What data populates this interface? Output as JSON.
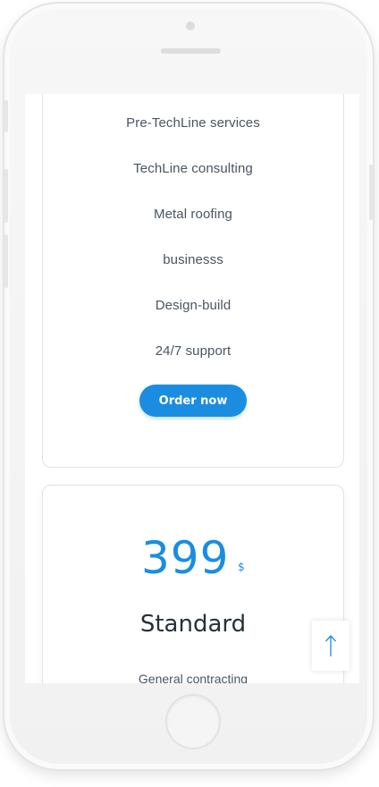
{
  "pricing_top": {
    "features": [
      "Pre-TechLine services",
      "TechLine consulting",
      "Metal roofing",
      "businesss",
      "Design-build",
      "24/7 support"
    ],
    "order_label": "Order now"
  },
  "pricing_bottom": {
    "price": "399",
    "currency": "$",
    "plan_name": "Standard",
    "first_feature": "General contracting"
  },
  "scroll_top": {
    "icon": "arrow-up-icon"
  },
  "colors": {
    "accent": "#1a8de1",
    "text": "#4a5561",
    "heading": "#26303a"
  }
}
